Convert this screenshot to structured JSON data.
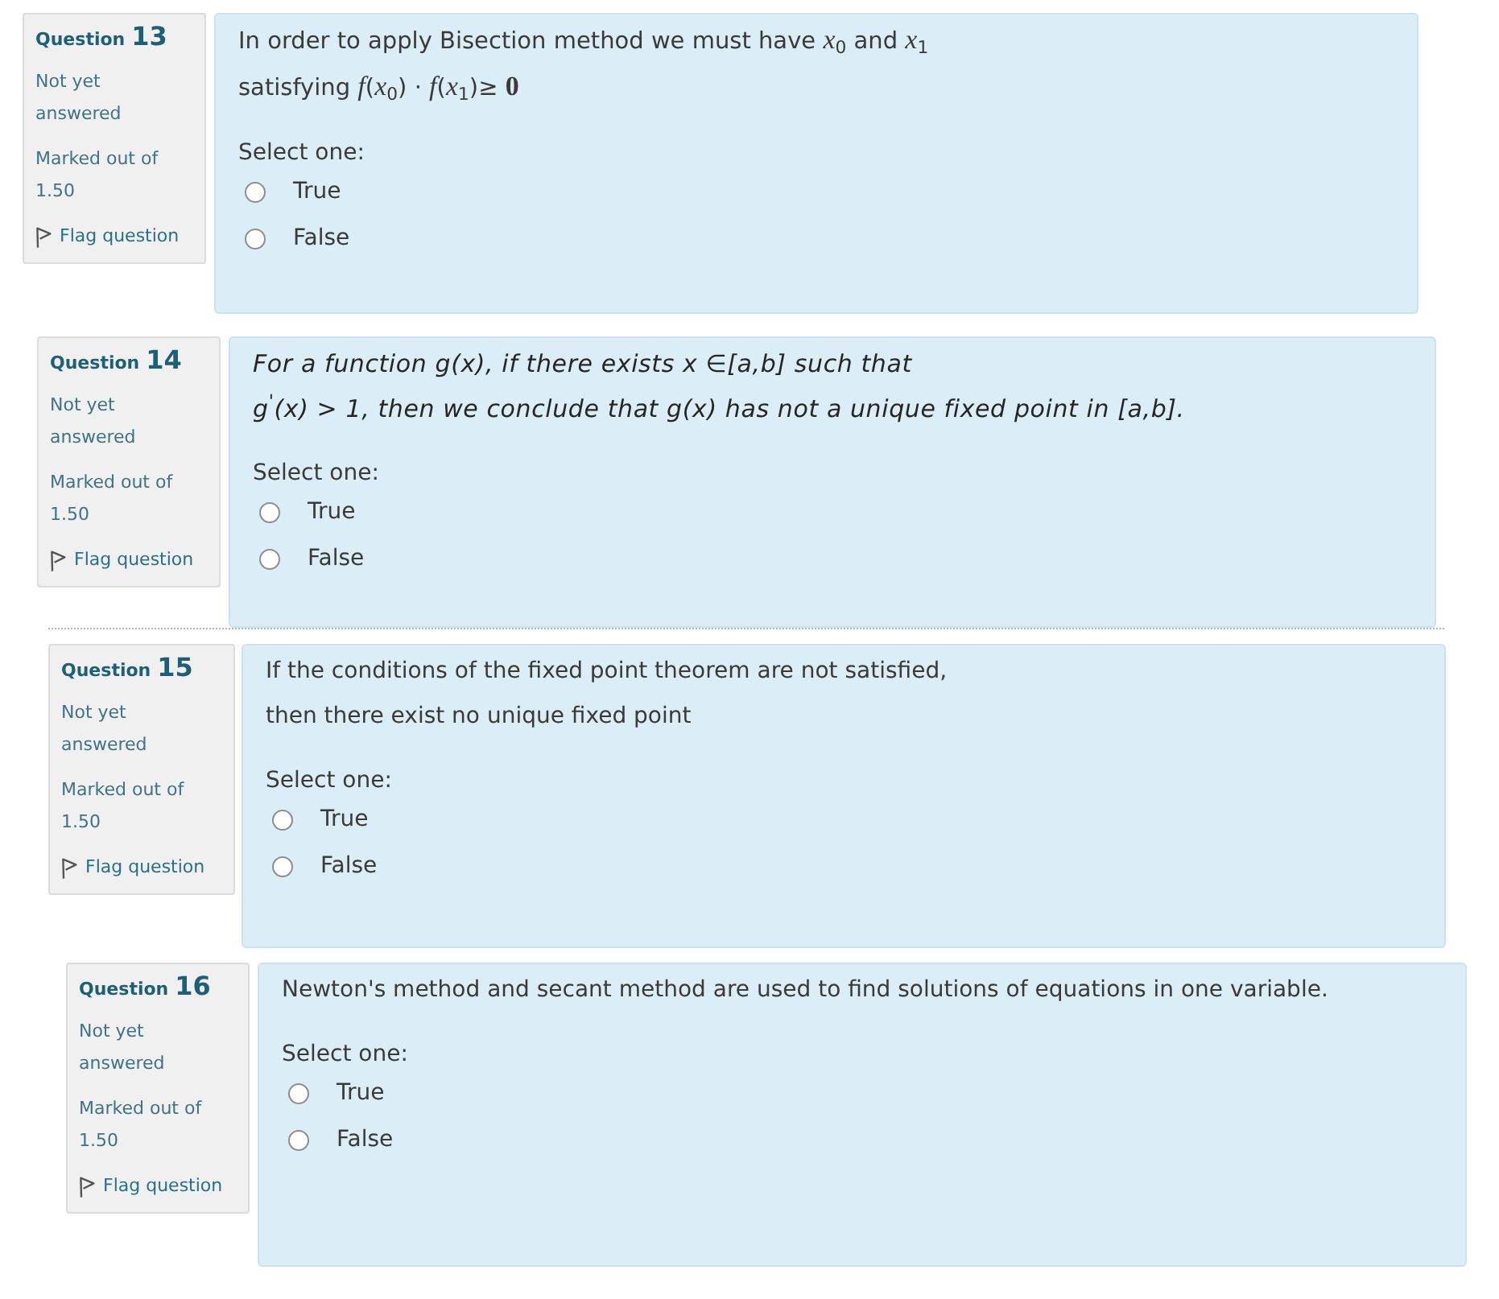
{
  "questions": [
    {
      "label": "Question",
      "number": "13",
      "status": "Not yet answered",
      "marks": "Marked out of 1.50",
      "flag": "Flag question",
      "italic": false,
      "lines": [
        "In order to apply Bisection method we must have *x*$_{0}$ and *x*$_{1}$",
        "satisfying *f*(*x*$_{0}$) · *f*(*x*$_{1}$)≥ **0**"
      ],
      "prompt": "Select one:",
      "options": [
        {
          "label": "True",
          "selected": false
        },
        {
          "label": "False",
          "selected": false
        }
      ]
    },
    {
      "label": "Question",
      "number": "14",
      "status": "Not yet answered",
      "marks": "Marked out of 1.50",
      "flag": "Flag question",
      "italic": true,
      "lines": [
        "For a function g(x), if there exists x ∈[a,b] such that",
        "g$^{'}$(x) > 1, then we conclude that g(x) has not a unique fixed point in [a,b]."
      ],
      "prompt": "Select one:",
      "options": [
        {
          "label": "True",
          "selected": false
        },
        {
          "label": "False",
          "selected": false
        }
      ]
    },
    {
      "label": "Question",
      "number": "15",
      "status": "Not yet answered",
      "marks": "Marked out of 1.50",
      "flag": "Flag question",
      "italic": false,
      "lines": [
        "If the conditions of the fixed point theorem are not satisfied,",
        "then there exist no unique fixed point"
      ],
      "prompt": "Select one:",
      "options": [
        {
          "label": "True",
          "selected": false
        },
        {
          "label": "False",
          "selected": false
        }
      ]
    },
    {
      "label": "Question",
      "number": "16",
      "status": "Not yet answered",
      "marks": "Marked out of 1.50",
      "flag": "Flag question",
      "italic": false,
      "lines": [
        "Newton's method and secant method are used to find solutions of equations in one variable."
      ],
      "prompt": "Select one:",
      "options": [
        {
          "label": "True",
          "selected": false
        },
        {
          "label": "False",
          "selected": false
        }
      ]
    }
  ]
}
